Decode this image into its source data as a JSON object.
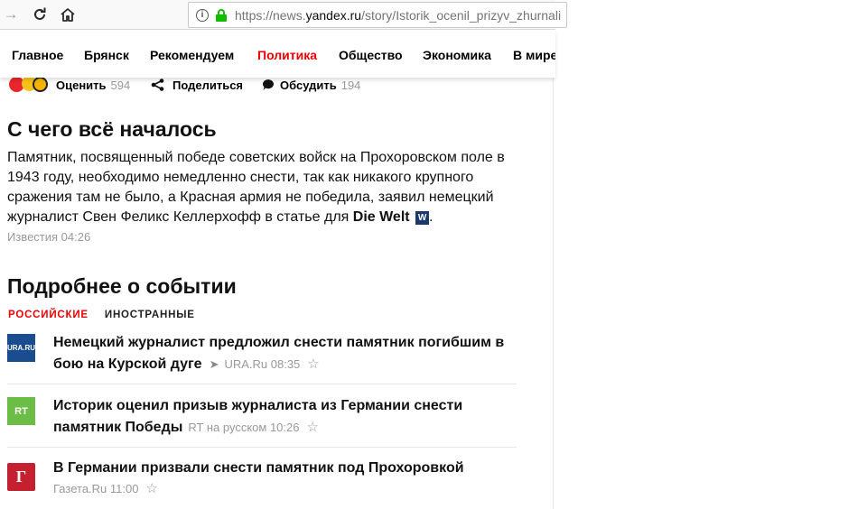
{
  "browser": {
    "url_prefix": "https://news.",
    "url_domain": "yandex.ru",
    "url_path": "/story/Istorik_ocenil_prizyv_zhurnali"
  },
  "nav": {
    "items": [
      "Главное",
      "Брянск",
      "Рекомендуем",
      "Политика",
      "Общество",
      "Экономика",
      "В мире"
    ],
    "active": "Политика"
  },
  "actions": {
    "rate_label": "Оценить",
    "rate_count": "594",
    "share_label": "Поделиться",
    "discuss_label": "Обсудить",
    "discuss_count": "194"
  },
  "summary": {
    "heading": "С чего всё началось",
    "text": "Памятник, посвященный победе советских войск на Прохоровском поле в 1943 году, необходимо немедленно снести, так как никакого крупного сражения там не было, а Красная армия не победила, заявил немецкий журналист Свен Феликс Келлерхофф в статье для ",
    "source_name": "Die Welt",
    "source_logo": "W",
    "meta": "Известия 04:26"
  },
  "details": {
    "heading": "Подробнее о событии",
    "tabs": [
      "РОССИЙСКИЕ",
      "ИНОСТРАННЫЕ"
    ],
    "stories": [
      {
        "title": "Немецкий журналист предложил снести памятник погибшим в бою на Курской дуге",
        "source": "URA.Ru 08:35",
        "logo_text": "URA.RU",
        "logo_color": "#1a4d8f"
      },
      {
        "title": "Историк оценил призыв журналиста из Германии снести памятник Победы",
        "source": "RT на русском 10:26",
        "logo_text": "RT",
        "logo_color": "#6cbd45"
      },
      {
        "title": "В Германии призвали снести памятник под Прохоровкой",
        "source": "Газета.Ru 11:00",
        "logo_text": "Г",
        "logo_color": "#c4202f"
      }
    ]
  },
  "icons": [
    "back-arrow-icon",
    "reload-icon",
    "home-icon",
    "info-icon",
    "lock-icon",
    "share-icon",
    "comment-icon",
    "star-icon",
    "rocket-icon"
  ]
}
